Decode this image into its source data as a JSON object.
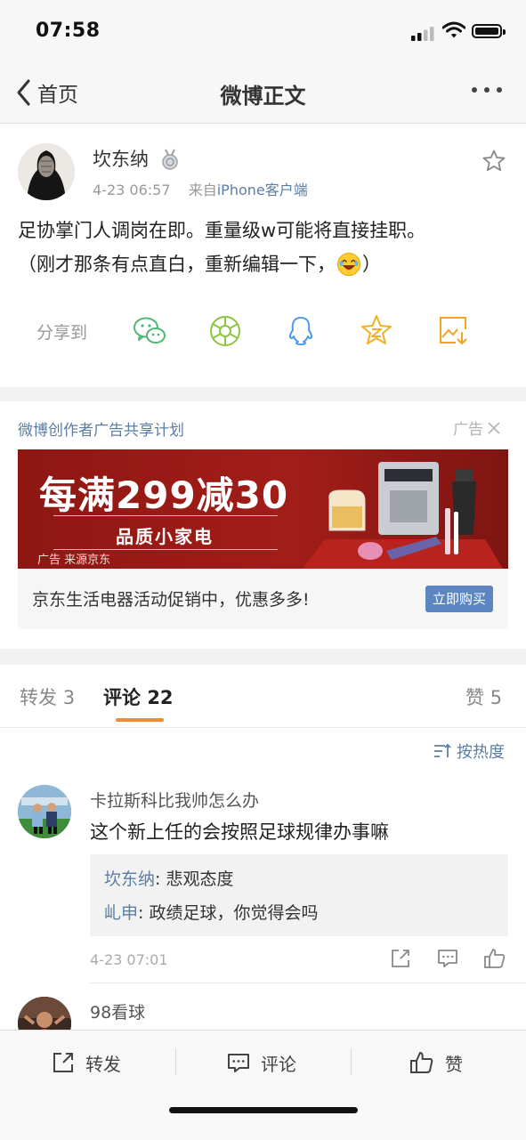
{
  "status_bar": {
    "time": "07:58"
  },
  "nav": {
    "back_label": "首页",
    "title": "微博正文"
  },
  "post": {
    "author": "坎东纳",
    "date": "4-23 06:57",
    "source_prefix": "来自",
    "source": "iPhone客户端",
    "line1": "足协掌门人调岗在即。重量级w可能将直接挂职。",
    "line2": "（刚才那条有点直白，重新编辑一下，",
    "line2_end": "）",
    "share_label": "分享到"
  },
  "ad": {
    "header": "微博创作者广告共享计划",
    "tag": "广告",
    "banner_headline": "每满299减30",
    "banner_sub": "品质小家电",
    "banner_source": "广告 来源京东",
    "description": "京东生活电器活动促销中，优惠多多!",
    "buy_label": "立即购买"
  },
  "tabs": {
    "repost_label": "转发",
    "repost_count": "3",
    "comment_label": "评论",
    "comment_count": "22",
    "like_label": "赞",
    "like_count": "5"
  },
  "sort_label": "按热度",
  "comments": [
    {
      "user": "卡拉斯科比我帅怎么办",
      "text": "这个新上任的会按照足球规律办事嘛",
      "replies": [
        {
          "name": "坎东纳",
          "text": ": 悲观态度"
        },
        {
          "name": "乢申",
          "text": ": 政绩足球，你觉得会吗"
        }
      ],
      "time": "4-23 07:01"
    },
    {
      "user": "98看球"
    }
  ],
  "bottom_bar": {
    "repost": "转发",
    "comment": "评论",
    "like": "赞"
  },
  "colors": {
    "link": "#5b7ea6",
    "accent": "#f08a33",
    "button": "#5b86c2",
    "banner": "#a21d18"
  }
}
